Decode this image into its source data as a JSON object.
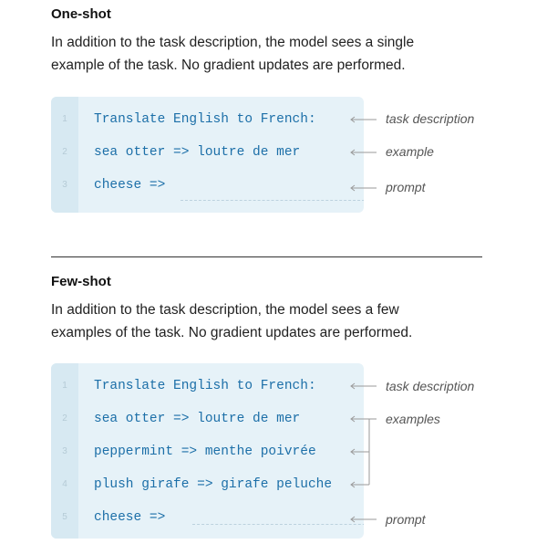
{
  "one_shot": {
    "title": "One-shot",
    "description_line1": "In addition to the task description, the model sees a single",
    "description_line2": "example of the task. No gradient updates are performed.",
    "lines": [
      {
        "number": "1",
        "code": "Translate English to French:"
      },
      {
        "number": "2",
        "code": "sea otter => loutre de mer"
      },
      {
        "number": "3",
        "code": "cheese =>"
      }
    ],
    "annotations": {
      "task": "task description",
      "example": "example",
      "prompt": "prompt"
    }
  },
  "few_shot": {
    "title": "Few-shot",
    "description_line1": "In addition to the task description, the model sees a few",
    "description_line2": "examples of the task. No gradient updates are performed.",
    "lines": [
      {
        "number": "1",
        "code": "Translate English to French:"
      },
      {
        "number": "2",
        "code": "sea otter => loutre de mer"
      },
      {
        "number": "3",
        "code": "peppermint => menthe poivrée"
      },
      {
        "number": "4",
        "code": "plush girafe => girafe peluche"
      },
      {
        "number": "5",
        "code": "cheese =>"
      }
    ],
    "annotations": {
      "task": "task description",
      "examples": "examples",
      "prompt": "prompt"
    }
  },
  "colors": {
    "code_background": "#e6f2f8",
    "code_text": "#1c6fa8",
    "annotation_text": "#555555"
  }
}
